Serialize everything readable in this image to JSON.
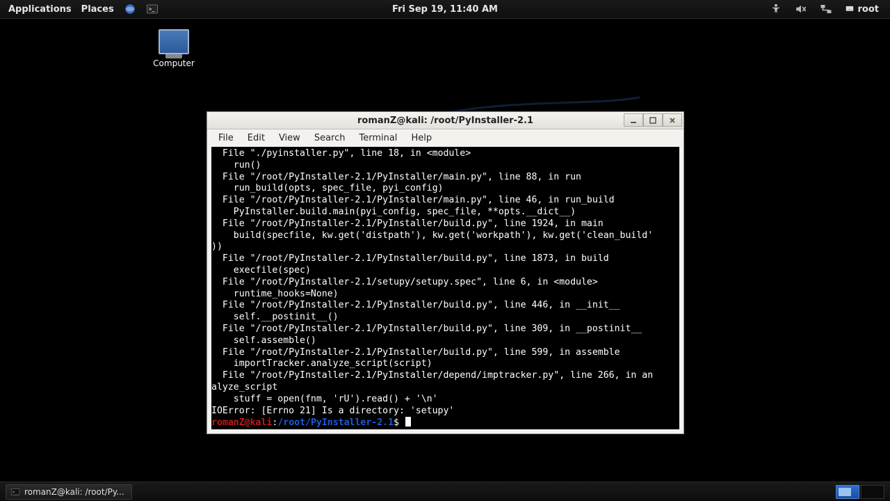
{
  "topbar": {
    "applications": "Applications",
    "places": "Places",
    "clock": "Fri Sep 19, 11:40 AM",
    "user": "root"
  },
  "desktop": {
    "computer_label": "Computer"
  },
  "window": {
    "title": "romanZ@kali: /root/PyInstaller-2.1",
    "menus": [
      "File",
      "Edit",
      "View",
      "Search",
      "Terminal",
      "Help"
    ]
  },
  "terminal": {
    "lines": [
      "  File \"./pyinstaller.py\", line 18, in <module>",
      "    run()",
      "  File \"/root/PyInstaller-2.1/PyInstaller/main.py\", line 88, in run",
      "    run_build(opts, spec_file, pyi_config)",
      "  File \"/root/PyInstaller-2.1/PyInstaller/main.py\", line 46, in run_build",
      "    PyInstaller.build.main(pyi_config, spec_file, **opts.__dict__)",
      "  File \"/root/PyInstaller-2.1/PyInstaller/build.py\", line 1924, in main",
      "    build(specfile, kw.get('distpath'), kw.get('workpath'), kw.get('clean_build'",
      "))",
      "  File \"/root/PyInstaller-2.1/PyInstaller/build.py\", line 1873, in build",
      "    execfile(spec)",
      "  File \"/root/PyInstaller-2.1/setupy/setupy.spec\", line 6, in <module>",
      "    runtime_hooks=None)",
      "  File \"/root/PyInstaller-2.1/PyInstaller/build.py\", line 446, in __init__",
      "    self.__postinit__()",
      "  File \"/root/PyInstaller-2.1/PyInstaller/build.py\", line 309, in __postinit__",
      "    self.assemble()",
      "  File \"/root/PyInstaller-2.1/PyInstaller/build.py\", line 599, in assemble",
      "    importTracker.analyze_script(script)",
      "  File \"/root/PyInstaller-2.1/PyInstaller/depend/imptracker.py\", line 266, in an",
      "alyze_script",
      "    stuff = open(fnm, 'rU').read() + '\\n'",
      "IOError: [Errno 21] Is a directory: 'setupy'"
    ],
    "prompt": {
      "user": "romanZ",
      "host": "kali",
      "path": "/root/PyInstaller-2.1",
      "symbol": "$"
    }
  },
  "taskbar": {
    "entry": "romanZ@kali: /root/Py..."
  }
}
